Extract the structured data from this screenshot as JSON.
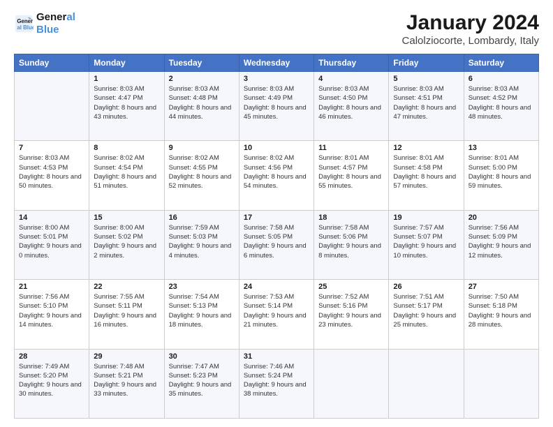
{
  "logo": {
    "line1": "General",
    "line2": "Blue"
  },
  "title": "January 2024",
  "subtitle": "Calolziocorte, Lombardy, Italy",
  "days_of_week": [
    "Sunday",
    "Monday",
    "Tuesday",
    "Wednesday",
    "Thursday",
    "Friday",
    "Saturday"
  ],
  "weeks": [
    [
      {
        "day": "",
        "sunrise": "",
        "sunset": "",
        "daylight": ""
      },
      {
        "day": "1",
        "sunrise": "Sunrise: 8:03 AM",
        "sunset": "Sunset: 4:47 PM",
        "daylight": "Daylight: 8 hours and 43 minutes."
      },
      {
        "day": "2",
        "sunrise": "Sunrise: 8:03 AM",
        "sunset": "Sunset: 4:48 PM",
        "daylight": "Daylight: 8 hours and 44 minutes."
      },
      {
        "day": "3",
        "sunrise": "Sunrise: 8:03 AM",
        "sunset": "Sunset: 4:49 PM",
        "daylight": "Daylight: 8 hours and 45 minutes."
      },
      {
        "day": "4",
        "sunrise": "Sunrise: 8:03 AM",
        "sunset": "Sunset: 4:50 PM",
        "daylight": "Daylight: 8 hours and 46 minutes."
      },
      {
        "day": "5",
        "sunrise": "Sunrise: 8:03 AM",
        "sunset": "Sunset: 4:51 PM",
        "daylight": "Daylight: 8 hours and 47 minutes."
      },
      {
        "day": "6",
        "sunrise": "Sunrise: 8:03 AM",
        "sunset": "Sunset: 4:52 PM",
        "daylight": "Daylight: 8 hours and 48 minutes."
      }
    ],
    [
      {
        "day": "7",
        "sunrise": "Sunrise: 8:03 AM",
        "sunset": "Sunset: 4:53 PM",
        "daylight": "Daylight: 8 hours and 50 minutes."
      },
      {
        "day": "8",
        "sunrise": "Sunrise: 8:02 AM",
        "sunset": "Sunset: 4:54 PM",
        "daylight": "Daylight: 8 hours and 51 minutes."
      },
      {
        "day": "9",
        "sunrise": "Sunrise: 8:02 AM",
        "sunset": "Sunset: 4:55 PM",
        "daylight": "Daylight: 8 hours and 52 minutes."
      },
      {
        "day": "10",
        "sunrise": "Sunrise: 8:02 AM",
        "sunset": "Sunset: 4:56 PM",
        "daylight": "Daylight: 8 hours and 54 minutes."
      },
      {
        "day": "11",
        "sunrise": "Sunrise: 8:01 AM",
        "sunset": "Sunset: 4:57 PM",
        "daylight": "Daylight: 8 hours and 55 minutes."
      },
      {
        "day": "12",
        "sunrise": "Sunrise: 8:01 AM",
        "sunset": "Sunset: 4:58 PM",
        "daylight": "Daylight: 8 hours and 57 minutes."
      },
      {
        "day": "13",
        "sunrise": "Sunrise: 8:01 AM",
        "sunset": "Sunset: 5:00 PM",
        "daylight": "Daylight: 8 hours and 59 minutes."
      }
    ],
    [
      {
        "day": "14",
        "sunrise": "Sunrise: 8:00 AM",
        "sunset": "Sunset: 5:01 PM",
        "daylight": "Daylight: 9 hours and 0 minutes."
      },
      {
        "day": "15",
        "sunrise": "Sunrise: 8:00 AM",
        "sunset": "Sunset: 5:02 PM",
        "daylight": "Daylight: 9 hours and 2 minutes."
      },
      {
        "day": "16",
        "sunrise": "Sunrise: 7:59 AM",
        "sunset": "Sunset: 5:03 PM",
        "daylight": "Daylight: 9 hours and 4 minutes."
      },
      {
        "day": "17",
        "sunrise": "Sunrise: 7:58 AM",
        "sunset": "Sunset: 5:05 PM",
        "daylight": "Daylight: 9 hours and 6 minutes."
      },
      {
        "day": "18",
        "sunrise": "Sunrise: 7:58 AM",
        "sunset": "Sunset: 5:06 PM",
        "daylight": "Daylight: 9 hours and 8 minutes."
      },
      {
        "day": "19",
        "sunrise": "Sunrise: 7:57 AM",
        "sunset": "Sunset: 5:07 PM",
        "daylight": "Daylight: 9 hours and 10 minutes."
      },
      {
        "day": "20",
        "sunrise": "Sunrise: 7:56 AM",
        "sunset": "Sunset: 5:09 PM",
        "daylight": "Daylight: 9 hours and 12 minutes."
      }
    ],
    [
      {
        "day": "21",
        "sunrise": "Sunrise: 7:56 AM",
        "sunset": "Sunset: 5:10 PM",
        "daylight": "Daylight: 9 hours and 14 minutes."
      },
      {
        "day": "22",
        "sunrise": "Sunrise: 7:55 AM",
        "sunset": "Sunset: 5:11 PM",
        "daylight": "Daylight: 9 hours and 16 minutes."
      },
      {
        "day": "23",
        "sunrise": "Sunrise: 7:54 AM",
        "sunset": "Sunset: 5:13 PM",
        "daylight": "Daylight: 9 hours and 18 minutes."
      },
      {
        "day": "24",
        "sunrise": "Sunrise: 7:53 AM",
        "sunset": "Sunset: 5:14 PM",
        "daylight": "Daylight: 9 hours and 21 minutes."
      },
      {
        "day": "25",
        "sunrise": "Sunrise: 7:52 AM",
        "sunset": "Sunset: 5:16 PM",
        "daylight": "Daylight: 9 hours and 23 minutes."
      },
      {
        "day": "26",
        "sunrise": "Sunrise: 7:51 AM",
        "sunset": "Sunset: 5:17 PM",
        "daylight": "Daylight: 9 hours and 25 minutes."
      },
      {
        "day": "27",
        "sunrise": "Sunrise: 7:50 AM",
        "sunset": "Sunset: 5:18 PM",
        "daylight": "Daylight: 9 hours and 28 minutes."
      }
    ],
    [
      {
        "day": "28",
        "sunrise": "Sunrise: 7:49 AM",
        "sunset": "Sunset: 5:20 PM",
        "daylight": "Daylight: 9 hours and 30 minutes."
      },
      {
        "day": "29",
        "sunrise": "Sunrise: 7:48 AM",
        "sunset": "Sunset: 5:21 PM",
        "daylight": "Daylight: 9 hours and 33 minutes."
      },
      {
        "day": "30",
        "sunrise": "Sunrise: 7:47 AM",
        "sunset": "Sunset: 5:23 PM",
        "daylight": "Daylight: 9 hours and 35 minutes."
      },
      {
        "day": "31",
        "sunrise": "Sunrise: 7:46 AM",
        "sunset": "Sunset: 5:24 PM",
        "daylight": "Daylight: 9 hours and 38 minutes."
      },
      {
        "day": "",
        "sunrise": "",
        "sunset": "",
        "daylight": ""
      },
      {
        "day": "",
        "sunrise": "",
        "sunset": "",
        "daylight": ""
      },
      {
        "day": "",
        "sunrise": "",
        "sunset": "",
        "daylight": ""
      }
    ]
  ]
}
